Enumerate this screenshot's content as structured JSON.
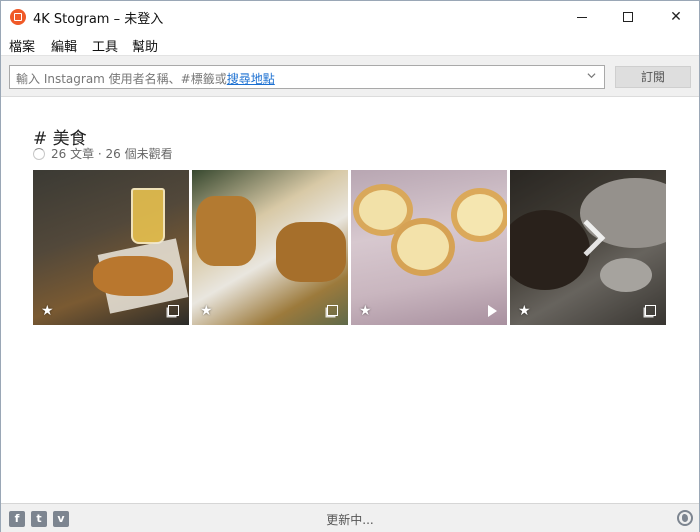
{
  "window": {
    "title": "4K Stogram – 未登入"
  },
  "menu": {
    "items": [
      "檔案",
      "編輯",
      "工具",
      "幫助"
    ]
  },
  "search": {
    "placeholder_prefix": "輸入 Instagram 使用者名稱、#標籤或",
    "placeholder_link": "搜尋地點",
    "subscribe_label": "訂閱"
  },
  "feed": {
    "tag_title": "# 美食",
    "meta": "26 文章 · 26 個未觀看",
    "thumbs": [
      {
        "name": "fried-chicken-beer",
        "badge": "multi-photo-icon"
      },
      {
        "name": "fried-skewers",
        "badge": "multi-photo-icon"
      },
      {
        "name": "egg-tarts",
        "badge": "video-play-icon"
      },
      {
        "name": "clams-dish",
        "badge": "multi-photo-icon"
      }
    ]
  },
  "status": {
    "text": "更新中...",
    "social": [
      "f",
      "t",
      "v"
    ]
  },
  "colors": {
    "accent": "#f05a28",
    "link": "#1a6fd1"
  }
}
